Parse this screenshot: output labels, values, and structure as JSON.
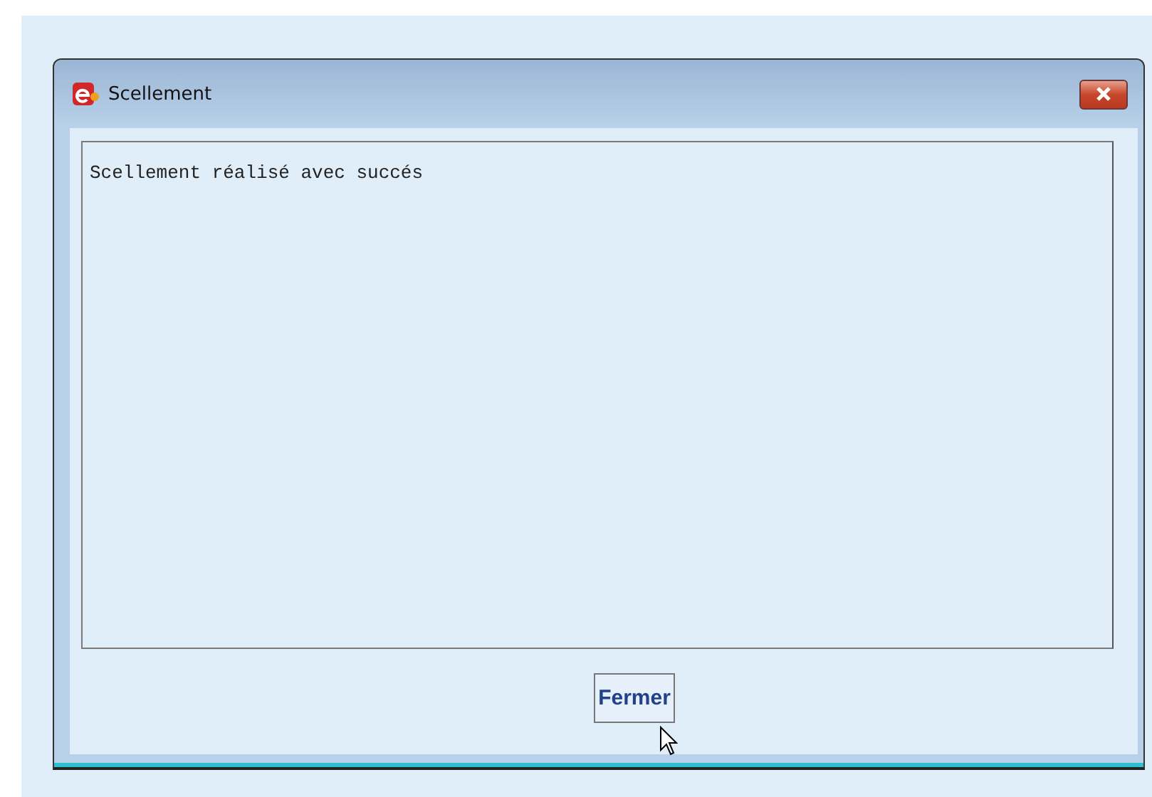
{
  "window": {
    "title": "Scellement"
  },
  "message": "Scellement réalisé avec succés",
  "buttons": [
    {
      "label": "Fermer"
    }
  ]
}
